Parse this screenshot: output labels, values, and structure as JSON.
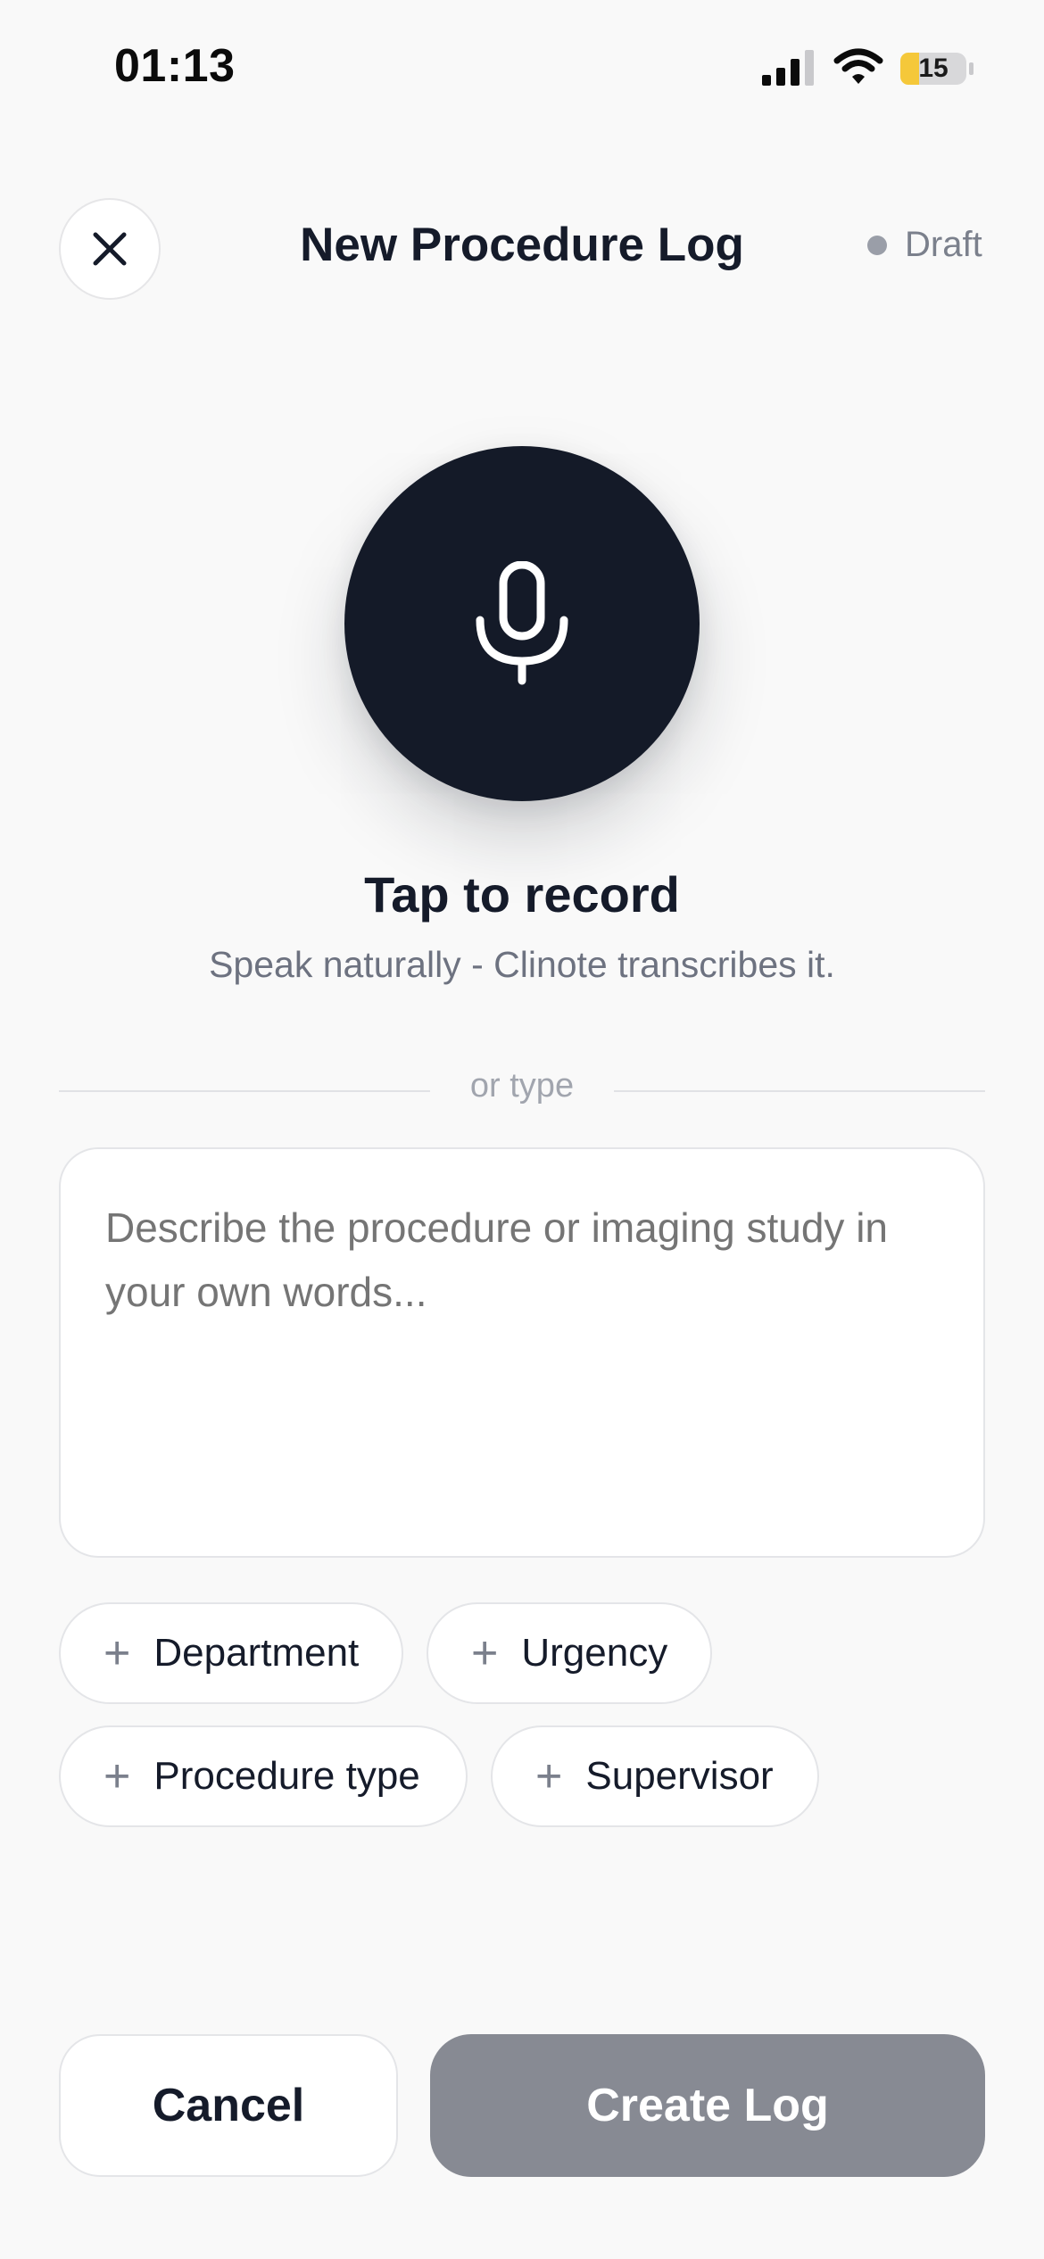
{
  "status_bar": {
    "time": "01:13",
    "battery_level": "15",
    "icons": [
      "signal-icon",
      "wifi-icon",
      "battery-icon"
    ]
  },
  "header": {
    "title": "New Procedure Log",
    "status_label": "Draft",
    "close_icon": "close-icon"
  },
  "record": {
    "icon": "microphone-icon",
    "title": "Tap to record",
    "subtitle": "Speak naturally - Clinote transcribes it."
  },
  "divider": {
    "label": "or type"
  },
  "description": {
    "value": "",
    "placeholder": "Describe the procedure or imaging study in your own words..."
  },
  "chips": [
    {
      "label": "Department",
      "icon": "plus-icon"
    },
    {
      "label": "Urgency",
      "icon": "plus-icon"
    },
    {
      "label": "Procedure type",
      "icon": "plus-icon"
    },
    {
      "label": "Supervisor",
      "icon": "plus-icon"
    }
  ],
  "actions": {
    "cancel_label": "Cancel",
    "create_label": "Create Log"
  },
  "colors": {
    "background": "#f9f9f9",
    "primary_dark": "#141a28",
    "disabled_button": "#878a93",
    "draft_dot": "#9a9ea8",
    "battery_fill": "#f5c83a"
  }
}
